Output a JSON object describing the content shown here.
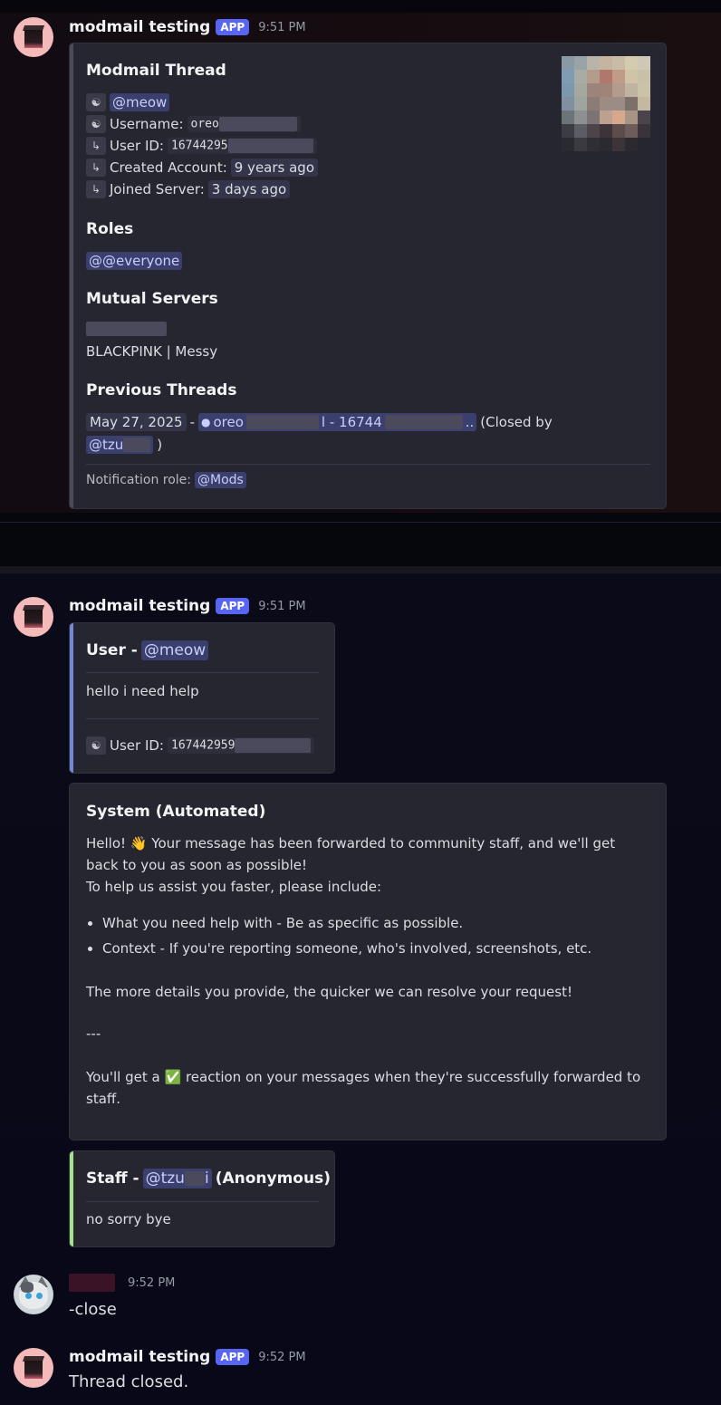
{
  "messages": {
    "m1": {
      "author": "modmail testing",
      "tag": "APP",
      "time": "9:51 PM",
      "embed": {
        "title": "Modmail Thread",
        "mention": "@meow",
        "username_label": "Username:",
        "username_value": "oreo",
        "userid_label": "User ID:",
        "userid_value": "16744295",
        "created_label": "Created Account:",
        "created_value": "9 years ago",
        "joined_label": "Joined Server:",
        "joined_value": "3 days ago",
        "roles_title": "Roles",
        "roles_value": "@@everyone",
        "mutual_title": "Mutual Servers",
        "mutual_server": "BLACKPINK | Messy",
        "prev_title": "Previous Threads",
        "prev_date": "May 27, 2025",
        "prev_dash": "-",
        "prev_link_a": "oreo",
        "prev_link_b": "l - 16744",
        "prev_link_c": "..",
        "prev_closed": "(Closed by",
        "prev_closer": "@tzu",
        "prev_close_paren": ")",
        "notif_label": "Notification role:",
        "notif_value": "@Mods"
      }
    },
    "m2": {
      "author": "modmail testing",
      "tag": "APP",
      "time": "9:51 PM",
      "user_embed": {
        "title": "User -",
        "mention": "@meow",
        "body": "hello i need help",
        "userid_label": "User ID:",
        "userid_value": "167442959"
      },
      "system_embed": {
        "title": "System (Automated)",
        "p1a": "Hello!",
        "p1b": "Your message has been forwarded to community staff, and we'll get back to you as soon as possible!",
        "p2": "To help us assist you faster, please include:",
        "bullets": [
          "What you need help with - Be as specific as possible.",
          "Context - If you're reporting someone, who's involved, screenshots, etc."
        ],
        "p3": "The more details you provide, the quicker we can resolve your request!",
        "sep": "---",
        "p4a": "You'll get a",
        "p4b": "reaction on your messages when they're successfully forwarded to staff."
      },
      "staff_embed": {
        "title": "Staff -",
        "mention_a": "@tzu",
        "mention_b": "i",
        "suffix": "(Anonymous)",
        "body": "no sorry bye"
      }
    },
    "m3": {
      "time": "9:52 PM",
      "text": "-close"
    },
    "m4": {
      "author": "modmail testing",
      "tag": "APP",
      "time": "9:52 PM",
      "text": "Thread closed."
    }
  },
  "icons": {
    "wave": "👋",
    "check": "✅",
    "thread": "thread-icon",
    "person": "person-icon",
    "reply_arrow": "reply-arrow-icon"
  },
  "colors": {
    "app_tag": "#5865f2",
    "user_bar": "#7289da",
    "staff_bar": "#a3e38b",
    "mention_bg": "#3b3f6e",
    "embed_bg": "#262630"
  }
}
